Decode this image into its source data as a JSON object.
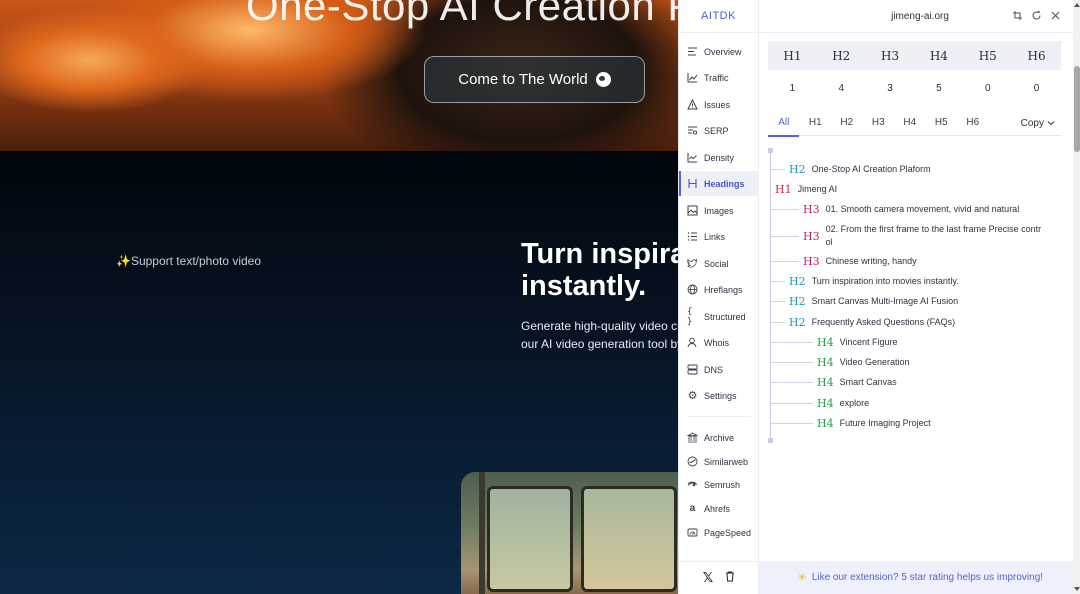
{
  "site": {
    "hero_title": "One-Stop AI Creation P",
    "hero_button": "Come to The World",
    "support_text": "✨Support text/photo video",
    "turn_title_l1": "Turn inspira",
    "turn_title_l2": "instantly.",
    "turn_desc_l1": "Generate high-quality video clip",
    "turn_desc_l2": "our AI video generation tool by J"
  },
  "extension": {
    "brand": "AITDK",
    "domain": "jimeng-ai.org",
    "nav": [
      {
        "label": "Overview",
        "icon": "overview-icon"
      },
      {
        "label": "Traffic",
        "icon": "traffic-icon"
      },
      {
        "label": "Issues",
        "icon": "warning-icon"
      },
      {
        "label": "SERP",
        "icon": "serp-icon"
      },
      {
        "label": "Density",
        "icon": "density-icon"
      },
      {
        "label": "Headings",
        "icon": "heading-icon"
      },
      {
        "label": "Images",
        "icon": "image-icon"
      },
      {
        "label": "Links",
        "icon": "links-icon"
      },
      {
        "label": "Social",
        "icon": "twitter-icon"
      },
      {
        "label": "Hreflangs",
        "icon": "globe-icon"
      },
      {
        "label": "Structured",
        "icon": "braces-icon"
      },
      {
        "label": "Whois",
        "icon": "user-icon"
      },
      {
        "label": "DNS",
        "icon": "server-icon"
      },
      {
        "label": "Settings",
        "icon": "gear-icon"
      }
    ],
    "tools": [
      {
        "label": "Archive",
        "icon": "archive-icon"
      },
      {
        "label": "Similarweb",
        "icon": "similarweb-icon"
      },
      {
        "label": "Semrush",
        "icon": "semrush-icon"
      },
      {
        "label": "Ahrefs",
        "icon": "ahrefs-icon"
      },
      {
        "label": "PageSpeed",
        "icon": "pagespeed-icon"
      }
    ],
    "heading_counts": {
      "headers": [
        "H1",
        "H2",
        "H3",
        "H4",
        "H5",
        "H6"
      ],
      "values": [
        "1",
        "4",
        "3",
        "5",
        "0",
        "0"
      ]
    },
    "tabs": [
      "All",
      "H1",
      "H2",
      "H3",
      "H4",
      "H5",
      "H6"
    ],
    "copy_label": "Copy",
    "headings": [
      {
        "tag": "H2",
        "text": "One-Stop AI Creation Plaform"
      },
      {
        "tag": "H1",
        "text": "Jimeng AI"
      },
      {
        "tag": "H3",
        "text": "01. Smooth camera movement, vivid and natural"
      },
      {
        "tag": "H3",
        "text": "02. From the first frame to the last frame Precise contr",
        "text2": "ol"
      },
      {
        "tag": "H3",
        "text": "Chinese writing, handy"
      },
      {
        "tag": "H2",
        "text": "Turn inspiration into movies instantly."
      },
      {
        "tag": "H2",
        "text": "Smart Canvas Multi-Image AI Fusion"
      },
      {
        "tag": "H2",
        "text": "Frequently Asked Questions (FAQs)"
      },
      {
        "tag": "H4",
        "text": "Vincent Figure"
      },
      {
        "tag": "H4",
        "text": "Video Generation"
      },
      {
        "tag": "H4",
        "text": "Smart Canvas"
      },
      {
        "tag": "H4",
        "text": "explore"
      },
      {
        "tag": "H4",
        "text": "Future Imaging Project"
      }
    ],
    "footer": "Like our extension? 5 star rating helps us improving!"
  }
}
